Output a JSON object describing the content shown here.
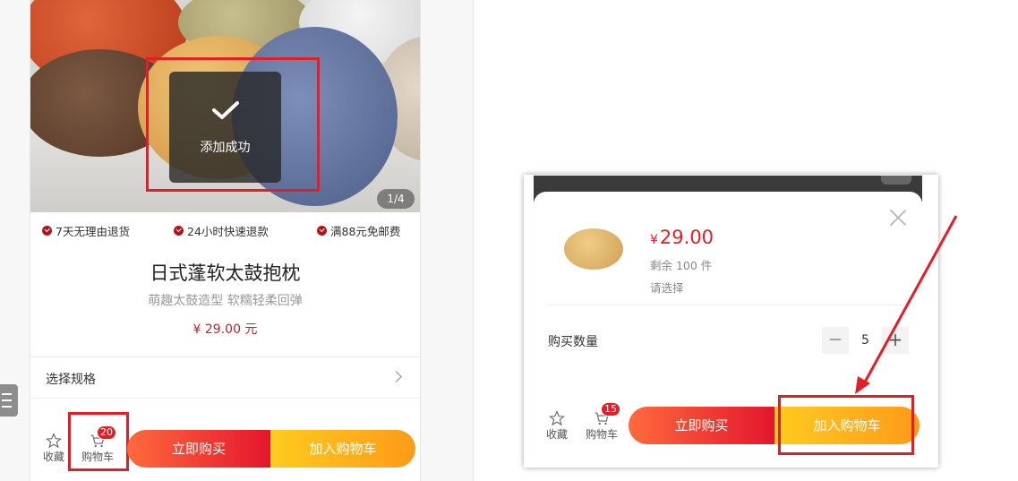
{
  "product": {
    "pager": "1/4",
    "toast": "添加成功",
    "guarantees": [
      "7天无理由退货",
      "24小时快速退款",
      "满88元免邮费"
    ],
    "title": "日式蓬软太鼓抱枕",
    "subtitle": "萌趣太鼓造型 软糯轻柔回弹",
    "price": "¥ 29.00 元",
    "spec_label": "选择规格"
  },
  "left_bar": {
    "favorite_label": "收藏",
    "cart_label": "购物车",
    "cart_count": "20",
    "buy_now": "立即购买",
    "add_to_cart": "加入购物车"
  },
  "modal": {
    "currency": "¥",
    "price": "29.00",
    "stock": "剩余 100 件",
    "choose": "请选择",
    "qty_label": "购买数量",
    "minus": "—",
    "qty": "5",
    "plus": "+",
    "favorite_label": "收藏",
    "cart_label": "购物车",
    "cart_count": "15",
    "buy_now": "立即购买",
    "add_to_cart": "加入购物车"
  },
  "colors": {
    "accent_red": "#e41e26",
    "price_red": "#b4282d",
    "buy_gradient": [
      "#ff6a3d",
      "#e4162d"
    ],
    "cart_gradient": [
      "#ffcb1f",
      "#ff9a1a"
    ]
  },
  "icons": [
    "check-icon",
    "menu-icon",
    "star-icon",
    "cart-icon",
    "chevron-right-icon",
    "close-icon"
  ]
}
